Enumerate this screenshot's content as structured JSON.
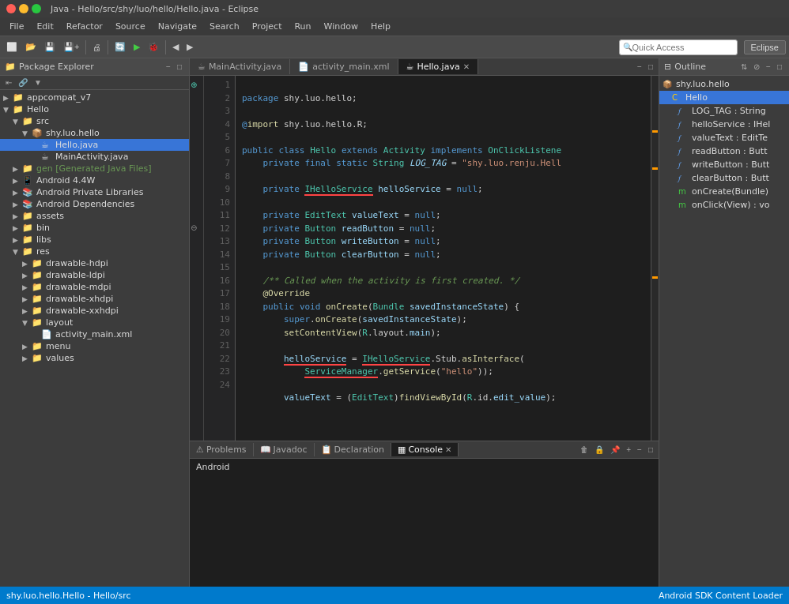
{
  "window": {
    "title": "Java - Hello/src/shy/luo/hello/Hello.java - Eclipse"
  },
  "titlebar": {
    "close": "×",
    "min": "−",
    "max": "□"
  },
  "menubar": {
    "items": [
      "File",
      "Edit",
      "Refactor",
      "Source",
      "Navigate",
      "Search",
      "Project",
      "Run",
      "Window",
      "Help"
    ]
  },
  "toolbar": {
    "quick_access_placeholder": "Quick Access",
    "eclipse_button": "Eclipse"
  },
  "package_explorer": {
    "title": "Package Explorer",
    "tree": [
      {
        "label": "appcompat_v7",
        "indent": 0,
        "icon": "📁",
        "arrow": "▶"
      },
      {
        "label": "Hello",
        "indent": 0,
        "icon": "📁",
        "arrow": "▼"
      },
      {
        "label": "src",
        "indent": 1,
        "icon": "📁",
        "arrow": "▼"
      },
      {
        "label": "shy.luo.hello",
        "indent": 2,
        "icon": "📦",
        "arrow": "▼"
      },
      {
        "label": "Hello.java",
        "indent": 3,
        "icon": "☕",
        "arrow": "",
        "selected": true
      },
      {
        "label": "MainActivity.java",
        "indent": 3,
        "icon": "☕",
        "arrow": ""
      },
      {
        "label": "gen [Generated Java Files]",
        "indent": 1,
        "icon": "📁",
        "arrow": "▶",
        "style": "generated"
      },
      {
        "label": "Android 4.4W",
        "indent": 1,
        "icon": "📱",
        "arrow": "▶"
      },
      {
        "label": "Android Private Libraries",
        "indent": 1,
        "icon": "📚",
        "arrow": "▶"
      },
      {
        "label": "Android Dependencies",
        "indent": 1,
        "icon": "📚",
        "arrow": "▶"
      },
      {
        "label": "assets",
        "indent": 1,
        "icon": "📁",
        "arrow": "▶"
      },
      {
        "label": "bin",
        "indent": 1,
        "icon": "📁",
        "arrow": "▶"
      },
      {
        "label": "libs",
        "indent": 1,
        "icon": "📁",
        "arrow": "▶"
      },
      {
        "label": "res",
        "indent": 1,
        "icon": "📁",
        "arrow": "▼"
      },
      {
        "label": "drawable-hdpi",
        "indent": 2,
        "icon": "📁",
        "arrow": "▶"
      },
      {
        "label": "drawable-ldpi",
        "indent": 2,
        "icon": "📁",
        "arrow": "▶"
      },
      {
        "label": "drawable-mdpi",
        "indent": 2,
        "icon": "📁",
        "arrow": "▶"
      },
      {
        "label": "drawable-xhdpi",
        "indent": 2,
        "icon": "📁",
        "arrow": "▶"
      },
      {
        "label": "drawable-xxhdpi",
        "indent": 2,
        "icon": "📁",
        "arrow": "▶"
      },
      {
        "label": "layout",
        "indent": 2,
        "icon": "📁",
        "arrow": "▼"
      },
      {
        "label": "activity_main.xml",
        "indent": 3,
        "icon": "📄",
        "arrow": ""
      },
      {
        "label": "menu",
        "indent": 2,
        "icon": "📁",
        "arrow": "▶"
      },
      {
        "label": "values",
        "indent": 2,
        "icon": "📁",
        "arrow": "▶"
      }
    ]
  },
  "editor": {
    "tabs": [
      {
        "label": "MainActivity.java",
        "active": false,
        "icon": "☕"
      },
      {
        "label": "activity_main.xml",
        "active": false,
        "icon": "📄"
      },
      {
        "label": "Hello.java",
        "active": true,
        "icon": "☕"
      }
    ],
    "code_lines": [
      {
        "num": "",
        "text": "package shy.luo.hello;"
      },
      {
        "num": "",
        "text": ""
      },
      {
        "num": "",
        "text": "@import shy.luo.hello.R;"
      },
      {
        "num": "",
        "text": ""
      },
      {
        "num": "",
        "text": "public class Hello extends Activity implements OnClickListene"
      },
      {
        "num": "",
        "text": "    private final static String LOG_TAG = \"shy.luo.renju.Hell"
      },
      {
        "num": "",
        "text": ""
      },
      {
        "num": "",
        "text": "    private IHelloService helloService = null;"
      },
      {
        "num": "",
        "text": ""
      },
      {
        "num": "",
        "text": "    private EditText valueText = null;"
      },
      {
        "num": "",
        "text": "    private Button readButton = null;"
      },
      {
        "num": "",
        "text": "    private Button writeButton = null;"
      },
      {
        "num": "",
        "text": "    private Button clearButton = null;"
      },
      {
        "num": "",
        "text": ""
      },
      {
        "num": "",
        "text": "    /** Called when the activity is first created. */"
      },
      {
        "num": "",
        "text": "    @Override"
      },
      {
        "num": "",
        "text": "    public void onCreate(Bundle savedInstanceState) {"
      },
      {
        "num": "",
        "text": "        super.onCreate(savedInstanceState);"
      },
      {
        "num": "",
        "text": "        setContentView(R.layout.main);"
      },
      {
        "num": "",
        "text": ""
      },
      {
        "num": "",
        "text": "        helloService = IHelloService.Stub.asInterface("
      },
      {
        "num": "",
        "text": "            ServiceManager.getService(\"hello\"));"
      },
      {
        "num": "",
        "text": ""
      },
      {
        "num": "",
        "text": "        valueText = (EditText)findViewById(R.id.edit_value);"
      }
    ]
  },
  "outline": {
    "title": "Outline",
    "items": [
      {
        "label": "shy.luo.hello",
        "indent": 0,
        "icon": "📦"
      },
      {
        "label": "Hello",
        "indent": 1,
        "icon": "C",
        "selected": true
      },
      {
        "label": "LOG_TAG : String",
        "indent": 2,
        "icon": "f"
      },
      {
        "label": "helloService : IHel",
        "indent": 2,
        "icon": "f"
      },
      {
        "label": "valueText : EditTe",
        "indent": 2,
        "icon": "f"
      },
      {
        "label": "readButton : Butt",
        "indent": 2,
        "icon": "f"
      },
      {
        "label": "writeButton : Butt",
        "indent": 2,
        "icon": "f"
      },
      {
        "label": "clearButton : Butt",
        "indent": 2,
        "icon": "f"
      },
      {
        "label": "onCreate(Bundle)",
        "indent": 2,
        "icon": "m"
      },
      {
        "label": "onClick(View) : vo",
        "indent": 2,
        "icon": "m"
      }
    ]
  },
  "bottom": {
    "tabs": [
      "Problems",
      "Javadoc",
      "Declaration",
      "Console"
    ],
    "active_tab": "Console",
    "console_content": "Android"
  },
  "statusbar": {
    "left": "shy.luo.hello.Hello - Hello/src",
    "right": "Android SDK Content Loader"
  }
}
